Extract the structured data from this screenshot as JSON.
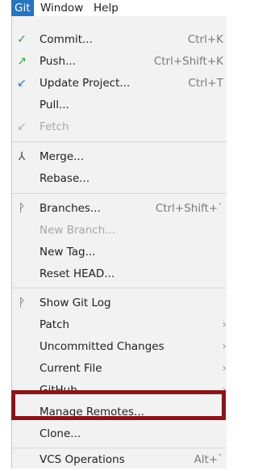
{
  "menubar": {
    "items": [
      {
        "label": "Git"
      },
      {
        "label": "Window"
      },
      {
        "label": "Help"
      }
    ]
  },
  "colors": {
    "active_menu": "#2675bf",
    "commit_icon": "#36a334",
    "push_icon": "#36a334",
    "update_icon": "#2d7ad6",
    "highlight_box": "#8b1418"
  },
  "menu": {
    "commit": {
      "label": "Commit...",
      "shortcut": "Ctrl+K",
      "icon": "checkmark-icon"
    },
    "push": {
      "label": "Push...",
      "shortcut": "Ctrl+Shift+K",
      "icon": "push-arrow-icon"
    },
    "update": {
      "label": "Update Project...",
      "shortcut": "Ctrl+T",
      "icon": "update-arrow-icon"
    },
    "pull": {
      "label": "Pull..."
    },
    "fetch": {
      "label": "Fetch",
      "icon": "fetch-icon"
    },
    "merge": {
      "label": "Merge...",
      "icon": "merge-icon"
    },
    "rebase": {
      "label": "Rebase..."
    },
    "branches": {
      "label": "Branches...",
      "shortcut": "Ctrl+Shift+`",
      "icon": "branch-icon"
    },
    "new_branch": {
      "label": "New Branch..."
    },
    "new_tag": {
      "label": "New Tag..."
    },
    "reset_head": {
      "label": "Reset HEAD..."
    },
    "show_git_log": {
      "label": "Show Git Log",
      "icon": "git-log-icon"
    },
    "patch": {
      "label": "Patch"
    },
    "uncommitted_changes": {
      "label": "Uncommitted Changes"
    },
    "current_file": {
      "label": "Current File"
    },
    "github": {
      "label": "GitHub"
    },
    "manage_remotes": {
      "label": "Manage Remotes..."
    },
    "clone": {
      "label": "Clone..."
    },
    "vcs_operations": {
      "label": "VCS Operations",
      "shortcut": "Alt+`"
    }
  }
}
